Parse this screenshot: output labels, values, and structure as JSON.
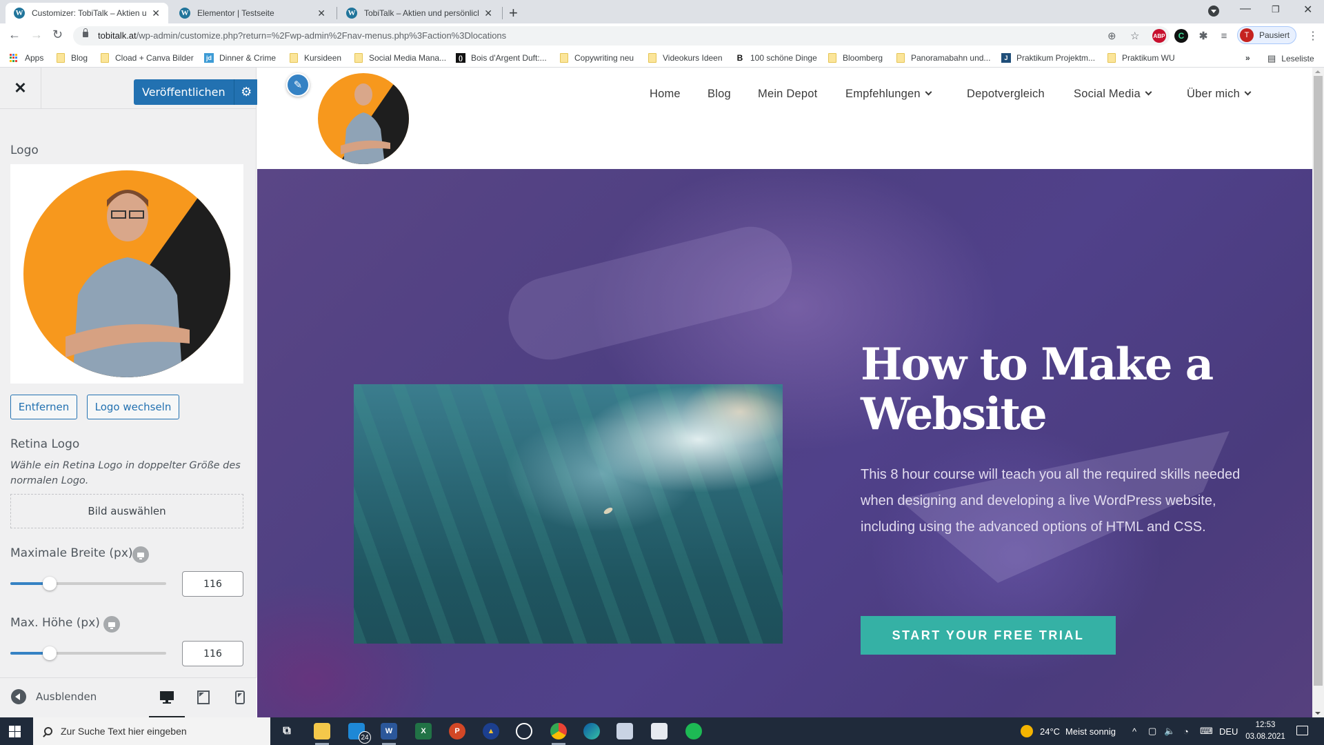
{
  "browser": {
    "tabs": [
      {
        "title": "Customizer: TobiTalk – Aktien und",
        "active": true
      },
      {
        "title": "Elementor | Testseite",
        "active": false
      },
      {
        "title": "TobiTalk – Aktien und persönliche",
        "active": false
      }
    ],
    "new_tab_label": "+",
    "url_host": "tobitalk.at",
    "url_path": "/wp-admin/customize.php?return=%2Fwp-admin%2Fnav-menus.php%3Faction%3Dlocations",
    "profile_initial": "T",
    "profile_status": "Pausiert",
    "extensions": [
      "ABP",
      "C"
    ],
    "bookmarks": [
      {
        "label": "Apps",
        "icon": "apps-grid-icon"
      },
      {
        "label": "Blog",
        "icon": "folder-icon"
      },
      {
        "label": "Cload + Canva Bilder",
        "icon": "folder-icon"
      },
      {
        "label": "Dinner & Crime",
        "icon": "jd-favicon"
      },
      {
        "label": "Kursideen",
        "icon": "folder-icon"
      },
      {
        "label": "Social Media Mana...",
        "icon": "folder-icon"
      },
      {
        "label": "Bois d'Argent Duft:...",
        "icon": "bois-favicon"
      },
      {
        "label": "Copywriting neu",
        "icon": "folder-icon"
      },
      {
        "label": "Videokurs Ideen",
        "icon": "folder-icon"
      },
      {
        "label": "100 schöne Dinge",
        "icon": "b-favicon"
      },
      {
        "label": "Bloomberg",
        "icon": "folder-icon"
      },
      {
        "label": "Panoramabahn und...",
        "icon": "folder-icon"
      },
      {
        "label": "Praktikum Projektm...",
        "icon": "j-favicon"
      },
      {
        "label": "Praktikum WU",
        "icon": "folder-icon"
      }
    ],
    "bookmarks_overflow": "»",
    "reading_list": "Leseliste"
  },
  "customizer": {
    "close_label": "✕",
    "publish_label": "Veröffentlichen",
    "logo_section_title": "Logo",
    "remove_button": "Entfernen",
    "change_logo_button": "Logo wechseln",
    "retina_title": "Retina Logo",
    "retina_description": "Wähle ein Retina Logo in doppelter Größe des normalen Logo.",
    "select_image_button": "Bild auswählen",
    "max_width_label": "Maximale Breite (px)",
    "max_width_value": "116",
    "max_width_fraction": 0.25,
    "max_height_label": "Max. Höhe (px)",
    "max_height_value": "116",
    "max_height_fraction": 0.25,
    "hide_label": "Ausblenden",
    "devices": [
      "desktop",
      "tablet",
      "mobile"
    ],
    "active_device": "desktop"
  },
  "site": {
    "nav": [
      {
        "label": "Home",
        "dropdown": false
      },
      {
        "label": "Blog",
        "dropdown": false
      },
      {
        "label": "Mein Depot",
        "dropdown": false
      },
      {
        "label": "Empfehlungen",
        "dropdown": true
      },
      {
        "label": "Depotvergleich",
        "dropdown": false
      },
      {
        "label": "Social Media",
        "dropdown": true
      },
      {
        "label": "Über mich",
        "dropdown": true
      }
    ],
    "hero_title": "How to Make a Website",
    "hero_text": "This 8 hour course will teach you all the required skills needed when designing and developing a live WordPress website, including using the advanced options of HTML and CSS.",
    "cta_label": "START YOUR FREE TRIAL",
    "accent_color": "#35b1a5",
    "logo_colors": {
      "orange": "#f7981d",
      "dark": "#1e1e1e"
    }
  },
  "taskbar": {
    "search_placeholder": "Zur Suche Text hier eingeben",
    "mail_badge": "24",
    "weather_temp": "24°C",
    "weather_text": "Meist sonnig",
    "language": "DEU",
    "time": "12:53",
    "date": "03.08.2021"
  }
}
